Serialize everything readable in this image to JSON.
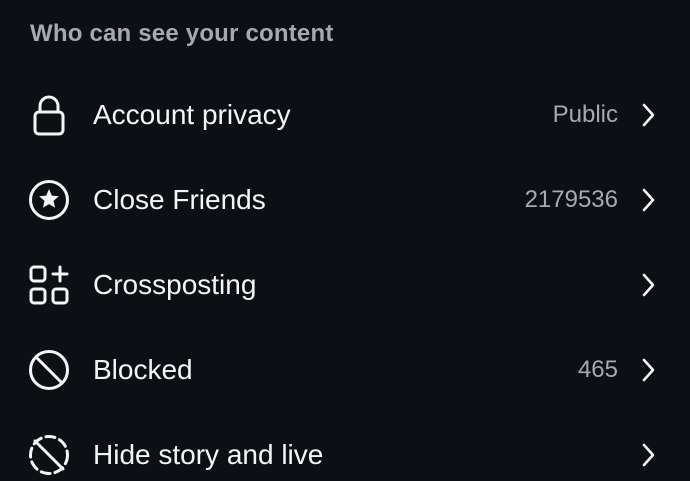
{
  "section": {
    "title": "Who can see your content"
  },
  "rows": [
    {
      "label": "Account privacy",
      "value": "Public",
      "icon": "lock-icon"
    },
    {
      "label": "Close Friends",
      "value": "2179536",
      "icon": "star-circle-icon"
    },
    {
      "label": "Crossposting",
      "value": "",
      "icon": "add-grid-icon"
    },
    {
      "label": "Blocked",
      "value": "465",
      "icon": "blocked-icon"
    },
    {
      "label": "Hide story and live",
      "value": "",
      "icon": "hide-story-icon"
    }
  ]
}
